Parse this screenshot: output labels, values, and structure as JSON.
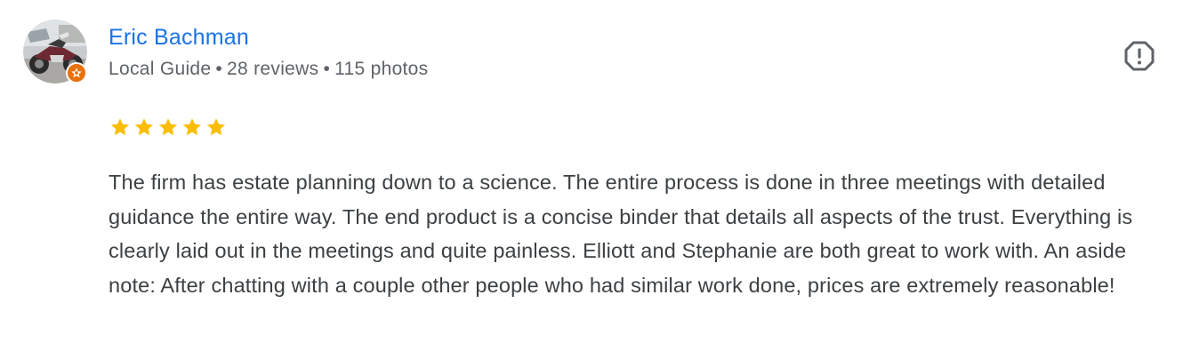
{
  "review": {
    "author": {
      "name": "Eric Bachman",
      "level": "Local Guide",
      "reviews": "28 reviews",
      "photos": "115 photos",
      "separator": "•",
      "avatar_icon": "motorcycle-photo",
      "badge_icon": "local-guide-star-icon"
    },
    "rating": {
      "stars": 5,
      "max": 5
    },
    "text": "The firm has estate planning down to a science. The entire process is done in three meetings with detailed guidance the entire way. The end product is a concise binder that details all aspects of the trust. Everything is clearly laid out in the meetings and quite painless. Elliott and Stephanie are both great to work with. An aside note: After chatting with a couple other people who had similar work done, prices are extremely reasonable!",
    "actions": {
      "flag_icon": "report-flag-icon"
    }
  },
  "colors": {
    "author_link": "#1a73e8",
    "meta_text": "#5f6368",
    "body_text": "#3c4043",
    "star": "#fbbc04",
    "badge": "#e8710a",
    "flag_icon": "#5f6368"
  }
}
